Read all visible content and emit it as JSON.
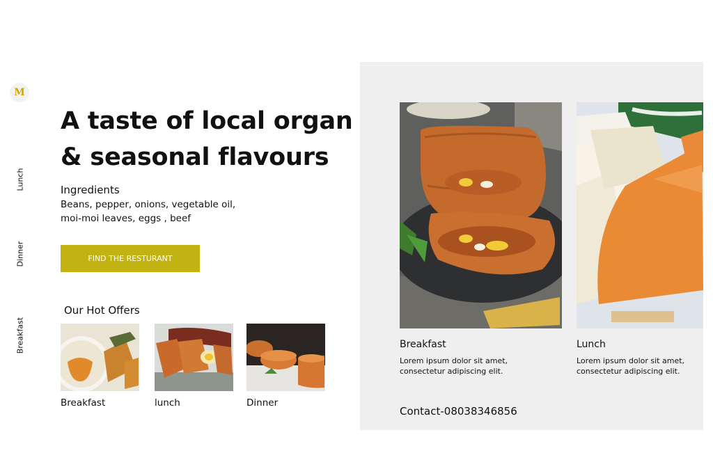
{
  "nav": {
    "logo_text": "M",
    "items": [
      {
        "label": "Lunch"
      },
      {
        "label": "Dinner"
      },
      {
        "label": "Breakfast"
      }
    ]
  },
  "hero": {
    "headline_line1": "A taste of local organ",
    "headline_line2": "& seasonal flavours",
    "ingredients_title": "Ingredients",
    "ingredients_line1": "Beans, pepper, onions, vegetable oil,",
    "ingredients_line2": "moi-moi leaves, eggs , beef",
    "cta_label": "FIND THE RESTURANT"
  },
  "offers": {
    "title": "Our Hot Offers",
    "items": [
      {
        "label": "Breakfast"
      },
      {
        "label": "lunch"
      },
      {
        "label": "Dinner"
      }
    ]
  },
  "featured": {
    "cards": [
      {
        "title": "Breakfast",
        "desc_line1": "Lorem ipsum dolor sit amet,",
        "desc_line2": "consectetur adipiscing elit."
      },
      {
        "title": "Lunch",
        "desc_line1": "Lorem ipsum dolor sit amet,",
        "desc_line2": "consectetur adipiscing elit."
      }
    ],
    "contact": "Contact-08038346856"
  },
  "colors": {
    "accent": "#c2b313",
    "panel": "#efefef",
    "moimoi": "#c96a2c"
  }
}
